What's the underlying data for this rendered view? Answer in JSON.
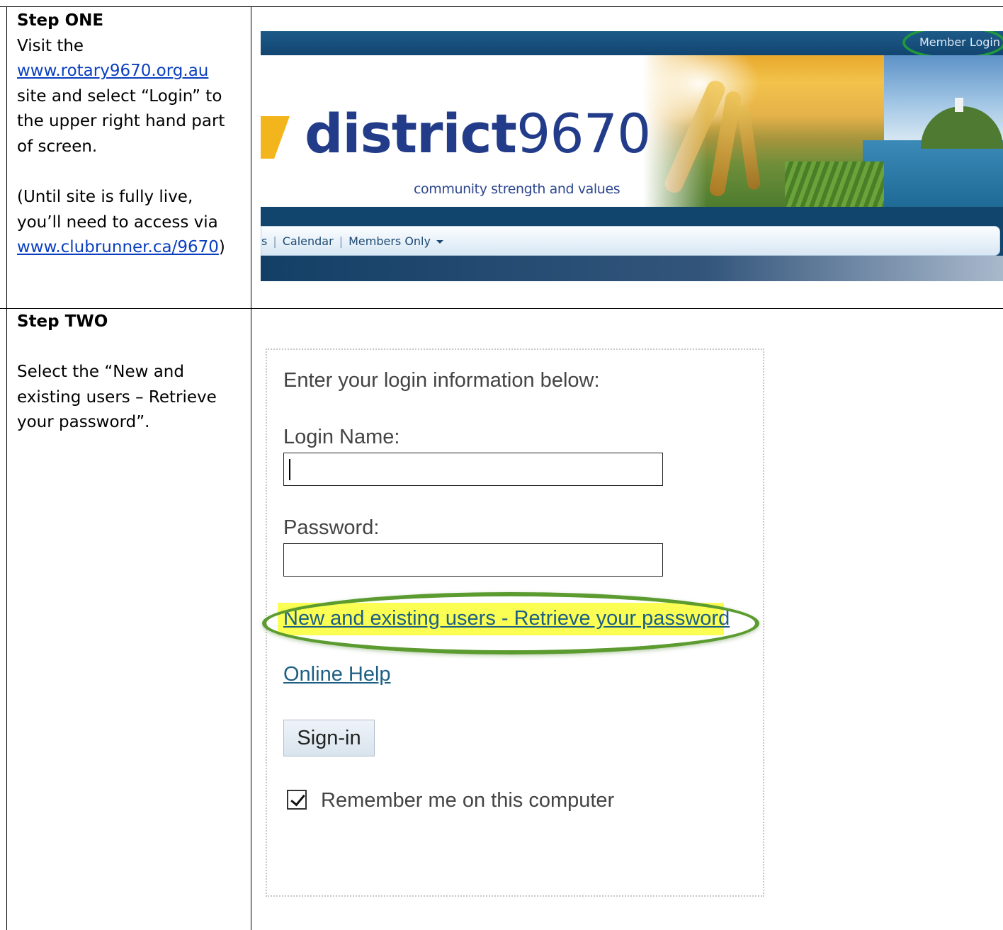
{
  "step_one": {
    "heading": "Step ONE",
    "line1": "Visit the",
    "link1": "www.rotary9670.org.au",
    "line2": "site and select “Login” to",
    "line3": "the upper right hand part",
    "line4": "of screen.",
    "line5": "(Until site is fully live,",
    "line6": "you’ll need to access via",
    "link2": "www.clubrunner.ca/9670",
    "link2_suffix": ")",
    "screenshot": {
      "member_login": "Member Login",
      "logo_word": "district",
      "logo_number": "9670",
      "tagline": "community strength and values",
      "nav_cut": "s",
      "nav_calendar": "Calendar",
      "nav_members": "Members Only"
    }
  },
  "step_two": {
    "heading": "Step TWO",
    "line1": "Select the “New and",
    "line2": "existing users – Retrieve",
    "line3": "your password”.",
    "login": {
      "prompt": "Enter your login information below:",
      "login_name_label": "Login Name:",
      "login_name_value": "",
      "password_label": "Password:",
      "password_value": "",
      "retrieve_link": "New and existing users - Retrieve your password",
      "online_help": "Online Help",
      "signin_button": "Sign-in",
      "remember_me": "Remember me on this computer",
      "remember_checked": true
    }
  }
}
